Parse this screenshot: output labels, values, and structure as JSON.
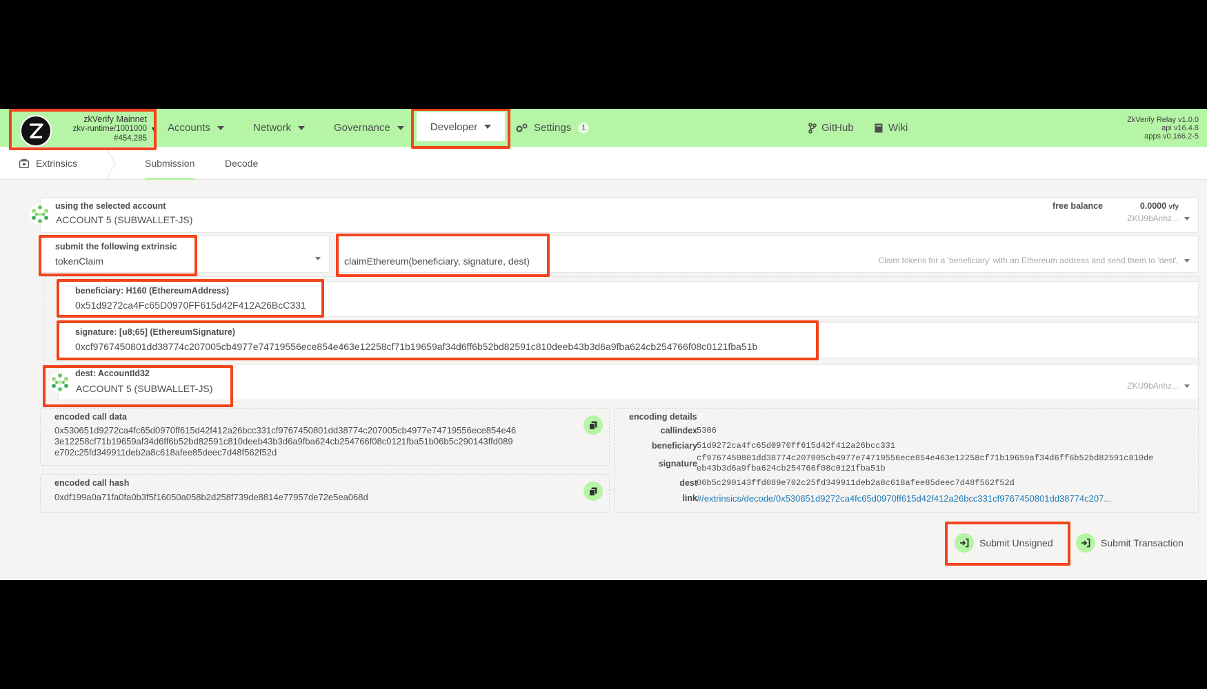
{
  "chain": {
    "name": "zkVerify Mainnet",
    "runtime": "zkv-runtime/1001000",
    "block": "#454,285"
  },
  "nav": {
    "accounts": "Accounts",
    "network": "Network",
    "governance": "Governance",
    "developer": "Developer",
    "settings": "Settings",
    "settings_badge": "1",
    "github": "GitHub",
    "wiki": "Wiki"
  },
  "version": {
    "relay": "ZkVerify Relay v1.0.0",
    "api": "api v16.4.8",
    "apps": "apps v0.166.2-5"
  },
  "subnav": {
    "title": "Extrinsics",
    "tabs": [
      "Submission",
      "Decode"
    ]
  },
  "account": {
    "label": "using the selected account",
    "value": "ACCOUNT 5 (SUBWALLET-JS)",
    "free_balance_label": "free balance",
    "free_balance_value": "0.0000",
    "free_balance_unit": "vfy",
    "address_short": "ZKU9bAnhz..."
  },
  "extrinsic": {
    "label": "submit the following extrinsic",
    "pallet": "tokenClaim",
    "call": "claimEthereum(beneficiary, signature, dest)",
    "description": "Claim tokens for a 'beneficiary' with an Ethereum address and send them to 'dest',"
  },
  "params": {
    "beneficiary_label": "beneficiary: H160 (EthereumAddress)",
    "beneficiary_value": "0x51d9272ca4Fc65D0970FF615d42F412A26BcC331",
    "signature_label": "signature: [u8;65] (EthereumSignature)",
    "signature_value": "0xcf9767450801dd38774c207005cb4977e74719556ece854e463e12258cf71b19659af34d6ff6b52bd82591c810deeb43b3d6a9fba624cb254766f08c0121fba51b",
    "dest_label": "dest: AccountId32",
    "dest_value": "ACCOUNT 5 (SUBWALLET-JS)",
    "dest_short": "ZKU9bAnhz..."
  },
  "encoded": {
    "call_data_label": "encoded call data",
    "call_data_line1": "0x530651d9272ca4fc65d0970ff615d42f412a26bcc331cf9767450801dd38774c207005cb4977e74719556ece854e46",
    "call_data_line2": "3e12258cf71b19659af34d6ff6b52bd82591c810deeb43b3d6a9fba624cb254766f08c0121fba51b06b5c290143ffd089",
    "call_data_line3": "e702c25fd349911deb2a8c618afee85deec7d48f562f52d",
    "call_hash_label": "encoded call hash",
    "call_hash_value": "0xdf199a0a71fa0fa0b3f5f16050a058b2d258f739de8814e77957de72e5ea068d"
  },
  "encoding_details": {
    "title": "encoding details",
    "callindex_label": "callindex",
    "callindex_value": "5306",
    "beneficiary_label": "beneficiary",
    "beneficiary_value": "51d9272ca4fc65d0970ff615d42f412a26bcc331",
    "signature_label": "signature",
    "signature_line1": "cf9767450801dd38774c207005cb4977e74719556ece854e463e12258cf71b19659af34d6ff6b52bd82591c810de",
    "signature_line2": "eb43b3d6a9fba624cb254766f08c0121fba51b",
    "dest_label": "dest",
    "dest_value": "06b5c290143ffd089e702c25fd349911deb2a8c618afee85deec7d48f562f52d",
    "link_label": "link",
    "link_value": "#/extrinsics/decode/0x530651d9272ca4fc65d0970ff615d42f412a26bcc331cf9767450801dd38774c207..."
  },
  "actions": {
    "submit_unsigned": "Submit Unsigned",
    "submit_transaction": "Submit Transaction"
  },
  "colors": {
    "accent": "#b5f5a5",
    "highlight": "#f2431a",
    "link": "#1a7ab8"
  }
}
